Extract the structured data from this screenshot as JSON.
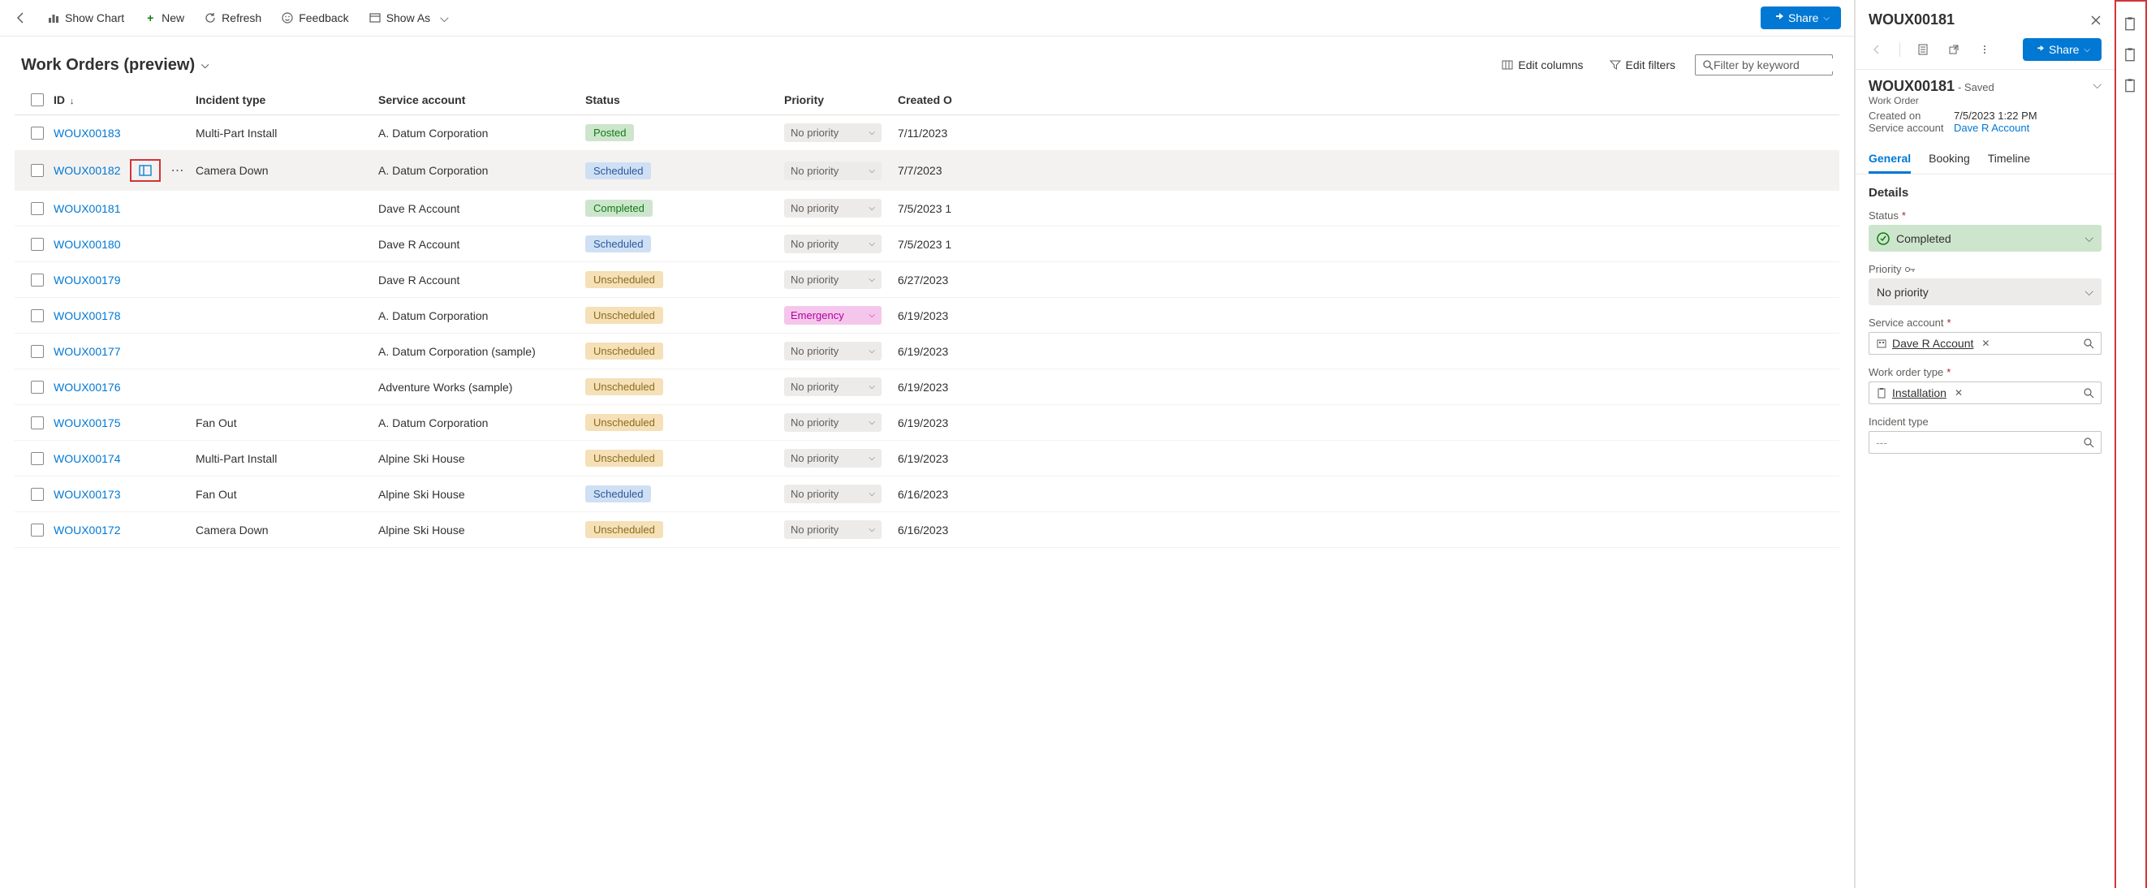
{
  "topbar": {
    "show_chart": "Show Chart",
    "new": "New",
    "refresh": "Refresh",
    "feedback": "Feedback",
    "show_as": "Show As",
    "share": "Share"
  },
  "view_title": "Work Orders (preview)",
  "edit_columns": "Edit columns",
  "edit_filters": "Edit filters",
  "filter_placeholder": "Filter by keyword",
  "columns": {
    "id": "ID",
    "incident": "Incident type",
    "account": "Service account",
    "status": "Status",
    "priority": "Priority",
    "created": "Created O"
  },
  "rows": [
    {
      "id": "WOUX00183",
      "incident": "Multi-Part Install",
      "account": "A. Datum Corporation",
      "status": "Posted",
      "priority": "No priority",
      "created": "7/11/2023"
    },
    {
      "id": "WOUX00182",
      "incident": "Camera Down",
      "account": "A. Datum Corporation",
      "status": "Scheduled",
      "priority": "No priority",
      "created": "7/7/2023",
      "hover": true,
      "show_preview": true
    },
    {
      "id": "WOUX00181",
      "incident": "",
      "account": "Dave R Account",
      "status": "Completed",
      "priority": "No priority",
      "created": "7/5/2023 1"
    },
    {
      "id": "WOUX00180",
      "incident": "",
      "account": "Dave R Account",
      "status": "Scheduled",
      "priority": "No priority",
      "created": "7/5/2023 1"
    },
    {
      "id": "WOUX00179",
      "incident": "",
      "account": "Dave R Account",
      "status": "Unscheduled",
      "priority": "No priority",
      "created": "6/27/2023"
    },
    {
      "id": "WOUX00178",
      "incident": "",
      "account": "A. Datum Corporation",
      "status": "Unscheduled",
      "priority": "Emergency",
      "created": "6/19/2023"
    },
    {
      "id": "WOUX00177",
      "incident": "",
      "account": "A. Datum Corporation (sample)",
      "status": "Unscheduled",
      "priority": "No priority",
      "created": "6/19/2023"
    },
    {
      "id": "WOUX00176",
      "incident": "",
      "account": "Adventure Works (sample)",
      "status": "Unscheduled",
      "priority": "No priority",
      "created": "6/19/2023"
    },
    {
      "id": "WOUX00175",
      "incident": "Fan Out",
      "account": "A. Datum Corporation",
      "status": "Unscheduled",
      "priority": "No priority",
      "created": "6/19/2023"
    },
    {
      "id": "WOUX00174",
      "incident": "Multi-Part Install",
      "account": "Alpine Ski House",
      "status": "Unscheduled",
      "priority": "No priority",
      "created": "6/19/2023"
    },
    {
      "id": "WOUX00173",
      "incident": "Fan Out",
      "account": "Alpine Ski House",
      "status": "Scheduled",
      "priority": "No priority",
      "created": "6/16/2023"
    },
    {
      "id": "WOUX00172",
      "incident": "Camera Down",
      "account": "Alpine Ski House",
      "status": "Unscheduled",
      "priority": "No priority",
      "created": "6/16/2023"
    }
  ],
  "side": {
    "title": "WOUX00181",
    "entity": "Work Order",
    "state": "Saved",
    "created_on_label": "Created on",
    "created_on": "7/5/2023 1:22 PM",
    "service_account_label": "Service account",
    "service_account": "Dave R Account",
    "share": "Share",
    "tabs": {
      "general": "General",
      "booking": "Booking",
      "timeline": "Timeline"
    },
    "details_heading": "Details",
    "status_label": "Status",
    "status_value": "Completed",
    "priority_label": "Priority",
    "priority_value": "No priority",
    "svc_acct_label": "Service account",
    "svc_acct_value": "Dave R Account",
    "wotype_label": "Work order type",
    "wotype_value": "Installation",
    "incident_label": "Incident type",
    "incident_placeholder": "---"
  }
}
